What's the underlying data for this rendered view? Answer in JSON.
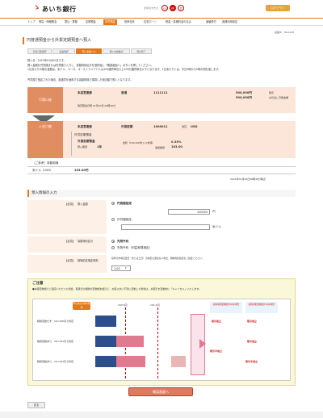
{
  "header": {
    "logo_text": "あいち銀行",
    "font_size_label": "文字の大きさ",
    "font_sizes": [
      "小",
      "中",
      "大"
    ],
    "logout_label": "ログアウト"
  },
  "nav": {
    "items": [
      "トップ",
      "残高・明細照会",
      "振込・振替",
      "定期預金",
      "外貨預金",
      "投資信託",
      "住宅ローン",
      "税金・各種料金の払込",
      "諸届受付",
      "各種利用設定"
    ],
    "active_index": 4
  },
  "page": {
    "id": "画面ID：BGA003",
    "title": "円普通預金から外貨定期預金へ預入"
  },
  "steps": [
    "引落口座選択",
    "商品選択",
    "預入金額入力",
    "預入内容確認",
    "受付完了"
  ],
  "intro": {
    "line1": "預入日：2021年01月20日です。",
    "line2": "預入金額を円貨額または外貨額で入力し、為替特約区分を選択後に「確認画面へ」ボタンを押してください。",
    "line3": "1日あたりの取引金額は、米ドル、ユーロ、オーストラリアドルは100通貨単位以上100万通貨単位以下となります。1日あたりとは、平日9時から0時の間を指します。",
    "line4": "円貨額で指定された場合、各通貨を適用する為替相場で換算した相当額で預入となります。"
  },
  "debit": {
    "side_label": "引落口座",
    "branch": "本店営業部",
    "type": "普通",
    "account": "1111111",
    "balance": "500,000円",
    "balance_label": "残高",
    "available": "500,000円",
    "available_label": "お引出し可能金額",
    "updated": "残高照会日時 01月20日 08時30分"
  },
  "deposit_account": {
    "side_label": "入金口座",
    "branch": "本店営業部",
    "type": "外貨定期",
    "account": "1000011",
    "currency_label": "通貨",
    "currency": "USD"
  },
  "product": {
    "section": "外貨定期預金",
    "name": "外貨定期預金",
    "term_label": "預入期間",
    "term": "1年",
    "rate_label": "金利（100,000米ドル未満）",
    "rate": "0.35%",
    "fx_label": "適用相場",
    "fx": "103.00"
  },
  "ref_rate": {
    "label": "（ご参考）為替相場",
    "currency": "米ドル（USD）",
    "value": "103.00円",
    "timestamp": "2021年01月20日08時30分時点"
  },
  "form": {
    "section_title": "預入情報の入力",
    "amount_required": "【必須】",
    "amount_label": "預入金額",
    "opt_yen": "円貨額指定",
    "yen_value": "100000",
    "yen_unit": "円",
    "opt_fx": "外貨額指定",
    "fx_unit": "米ドル",
    "contract_required": "【必須】",
    "contract_label": "為替特約区分",
    "contract_opt1": "先物予約",
    "contract_opt2": "先物予約（利益実現指定）",
    "time_required": "【必須】",
    "time_label": "相場約定指定時刻",
    "time_note": "基準の市場変更日（または土日）の約定を選ばない場合、相場約定指定をご指定ください。",
    "time_value": "1:00"
  },
  "notice": {
    "title": "ご注意",
    "text": "●許容変動幅でご指定いただいた場合、取扱日の相場が変動幅を超えて、お客さまに不利に変動した場合は、お取引を自動的に「キャンセル」いたします。",
    "ref_label": "申込時点の参考相場",
    "rate_a": "103.0円",
    "rate_b": "101.0円",
    "row1": "相場変動せず：1$=100円で約定",
    "row2": "相場変動あり：1$=101円で約定",
    "row3": "相場変動あり：1$=102円で約定",
    "col1": "許容可能変動幅が0円の場合",
    "col2": "許容可能変動幅が1円の場合",
    "res_ok": "取引成立",
    "res_ng": "取引不成立"
  },
  "buttons": {
    "confirm": "確認画面へ",
    "back": "戻る"
  },
  "colors": {
    "accent": "#e2791a",
    "card_side": "#e08d62",
    "card_body": "#fbe6d9"
  }
}
